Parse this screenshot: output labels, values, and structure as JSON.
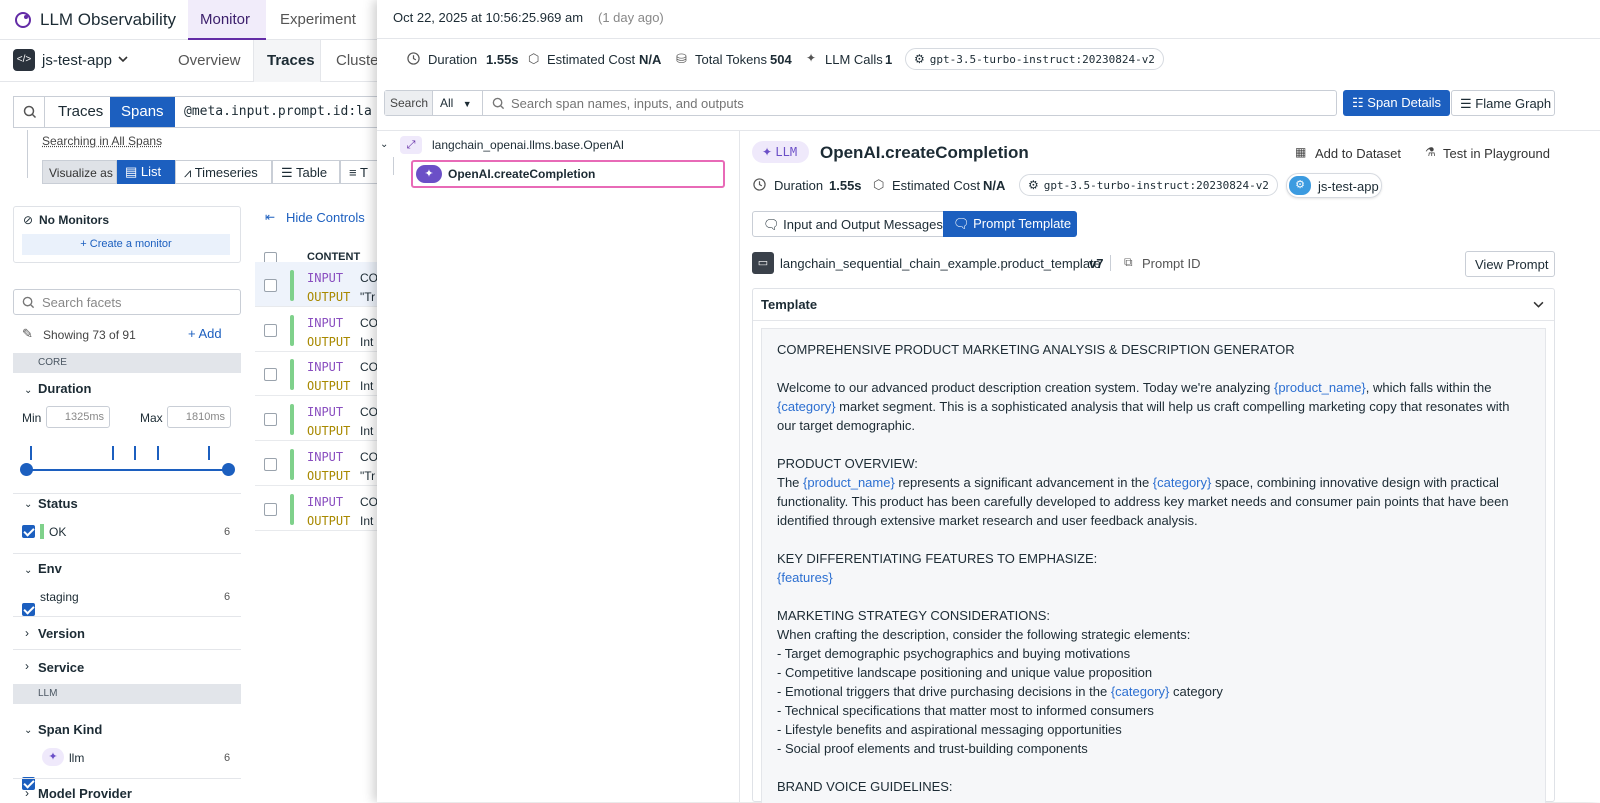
{
  "app": {
    "title": "LLM Observability",
    "tabs": [
      "Monitor",
      "Experiment"
    ],
    "active_tab": "Monitor"
  },
  "service_selector": {
    "name": "js-test-app"
  },
  "subnav": {
    "items": [
      "Overview",
      "Traces",
      "Clusters"
    ],
    "active": "Traces"
  },
  "search_bar": {
    "toggle": [
      "Traces",
      "Spans"
    ],
    "active": "Spans",
    "query": "@meta.input.prompt.id:la"
  },
  "searching_in": "Searching in All Spans",
  "visualize": {
    "label": "Visualize as",
    "options": [
      "List",
      "Timeseries",
      "Table",
      "T"
    ],
    "active": "List"
  },
  "monitors": {
    "label": "No Monitors",
    "create": "Create a monitor"
  },
  "facets": {
    "search_placeholder": "Search facets",
    "showing": "Showing 73 of 91",
    "add": "Add",
    "core_label": "CORE",
    "llm_label": "LLM",
    "duration": {
      "label": "Duration",
      "min_label": "Min",
      "min": "1325ms",
      "max_label": "Max",
      "max": "1810ms"
    },
    "status": {
      "label": "Status",
      "value": "OK",
      "count": "6"
    },
    "env": {
      "label": "Env",
      "value": "staging",
      "count": "6"
    },
    "version": "Version",
    "service": "Service",
    "span_kind": {
      "label": "Span Kind",
      "value": "llm",
      "count": "6"
    },
    "model_provider": "Model Provider"
  },
  "list": {
    "hide_controls": "Hide Controls",
    "content_header": "CONTENT",
    "rows": [
      {
        "in": "INPUT",
        "out": "OUTPUT",
        "t1": "CO",
        "t2": "\"Tr"
      },
      {
        "in": "INPUT",
        "out": "OUTPUT",
        "t1": "CO",
        "t2": "Int"
      },
      {
        "in": "INPUT",
        "out": "OUTPUT",
        "t1": "CO",
        "t2": "Int"
      },
      {
        "in": "INPUT",
        "out": "OUTPUT",
        "t1": "CO",
        "t2": "Int"
      },
      {
        "in": "INPUT",
        "out": "OUTPUT",
        "t1": "CO",
        "t2": "\"Tr"
      },
      {
        "in": "INPUT",
        "out": "OUTPUT",
        "t1": "CO",
        "t2": "Int"
      }
    ]
  },
  "panel": {
    "timestamp": "Oct 22, 2025 at 10:56:25.969 am",
    "relative": "(1 day ago)",
    "stats": {
      "duration_label": "Duration",
      "duration": "1.55s",
      "cost_label": "Estimated Cost",
      "cost": "N/A",
      "tokens_label": "Total Tokens",
      "tokens": "504",
      "calls_label": "LLM Calls",
      "calls": "1",
      "model": "gpt-3.5-turbo-instruct:20230824-v2"
    },
    "search": {
      "label": "Search",
      "scope": "All",
      "placeholder": "Search span names, inputs, and outputs"
    },
    "view_tabs": {
      "span_details": "Span Details",
      "flame_graph": "Flame Graph"
    },
    "tree": {
      "root": "langchain_openai.llms.base.OpenAI",
      "child": "OpenAI.createCompletion"
    },
    "span": {
      "kind": "LLM",
      "name": "OpenAI.createCompletion",
      "add_dataset": "Add to Dataset",
      "playground": "Test in Playground",
      "duration_label": "Duration",
      "duration": "1.55s",
      "cost_label": "Estimated Cost",
      "cost": "N/A",
      "model": "gpt-3.5-turbo-instruct:20230824-v2",
      "service": "js-test-app",
      "tabs": {
        "io": "Input and Output Messages",
        "prompt": "Prompt Template"
      },
      "template_name": "langchain_sequential_chain_example.product_template",
      "version": "v7",
      "prompt_id": "Prompt ID",
      "view_prompt": "View Prompt",
      "section": "Template"
    },
    "template": {
      "heading": "COMPREHENSIVE PRODUCT MARKETING ANALYSIS & DESCRIPTION GENERATOR",
      "p1a": "Welcome to our advanced product description creation system. Today we're analyzing ",
      "v_product": "{product_name}",
      "p1b": ", which falls within the ",
      "v_category": "{category}",
      "p1c": " market segment. This is a sophisticated analysis that will help us craft compelling marketing copy that resonates with our target demographic.",
      "overview_h": "PRODUCT OVERVIEW:",
      "p2a": "The ",
      "p2b": " represents a significant advancement in the ",
      "p2c": " space, combining innovative design with practical functionality. This product has been carefully developed to address key market needs and consumer pain points that have been identified through extensive market research and user feedback analysis.",
      "features_h": "KEY DIFFERENTIATING FEATURES TO EMPHASIZE:",
      "v_features": "{features}",
      "strategy_h": "MARKETING STRATEGY CONSIDERATIONS:",
      "strategy_intro": "When crafting the description, consider the following strategic elements:",
      "b1": "- Target demographic psychographics and buying motivations",
      "b2": "- Competitive landscape positioning and unique value proposition",
      "b3a": "- Emotional triggers that drive purchasing decisions in the ",
      "b3b": " category",
      "b4": "- Technical specifications that matter most to informed consumers",
      "b5": "- Lifestyle benefits and aspirational messaging opportunities",
      "b6": "- Social proof elements and trust-building components",
      "brand_h": "BRAND VOICE GUIDELINES:"
    }
  },
  "colors": {
    "accent": "#1c5fbf",
    "purple": "#632ca6",
    "llm_badge": "#6b4fc7"
  }
}
